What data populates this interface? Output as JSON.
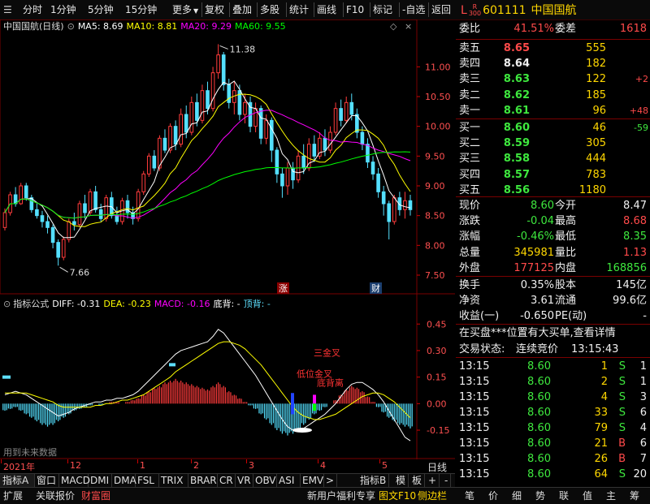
{
  "toolbar": {
    "left_items": [
      "分时",
      "1分钟",
      "5分钟",
      "15分钟",
      "更多"
    ],
    "right_items": [
      "复权",
      "叠加",
      "多股",
      "统计",
      "画线",
      "F10",
      "标记",
      "-自选",
      "返回"
    ]
  },
  "main_chart": {
    "title": "中国国航(日线)",
    "ma5": "MA5: 8.69",
    "ma10": "MA10: 8.81",
    "ma20": "MA20: 9.29",
    "ma60": "MA60: 9.55",
    "high_label": "11.38",
    "low_label": "7.66",
    "rise_mark": "涨",
    "fin_mark": "财"
  },
  "sub_chart": {
    "title": "指标公式",
    "diff": "DIFF: -0.31",
    "dea": "DEA: -0.23",
    "macd": "MACD: -0.16",
    "dibei": "底背: -",
    "dingbei": "顶背: -",
    "ann1": "三金叉",
    "ann2": "低位金叉",
    "ann3": "底背离",
    "future": "用到未来数据"
  },
  "colors": {
    "up": "#ff3b3b",
    "down": "#54e0ff",
    "ma5": "#ffffff",
    "ma10": "#ffff00",
    "ma20": "#ff00ff",
    "ma60": "#00ff00"
  },
  "chart_data": {
    "type": "candlestick",
    "price_axis": [
      "11.00",
      "10.50",
      "10.00",
      "9.50",
      "9.00",
      "8.50",
      "8.00",
      "7.50"
    ],
    "price_range": [
      7.35,
      11.55
    ],
    "macd_axis": [
      "0.45",
      "0.30",
      "0.15",
      "0.00",
      "-0.15"
    ],
    "macd_range": [
      -0.26,
      0.52
    ],
    "time_ticks": [
      "2021年",
      "12",
      "1",
      "2",
      "3",
      "4",
      "5"
    ],
    "candles": [
      [
        8.3,
        8.55,
        8.25,
        8.62
      ],
      [
        8.55,
        8.85,
        8.5,
        8.9
      ],
      [
        8.85,
        8.7,
        8.65,
        8.98
      ],
      [
        8.7,
        9.0,
        8.68,
        9.05
      ],
      [
        9.0,
        8.8,
        8.75,
        9.05
      ],
      [
        8.8,
        8.6,
        8.55,
        8.85
      ],
      [
        8.6,
        8.5,
        8.45,
        8.7
      ],
      [
        8.5,
        8.4,
        8.3,
        8.58
      ],
      [
        8.4,
        8.3,
        8.2,
        8.5
      ],
      [
        8.3,
        8.05,
        7.95,
        8.35
      ],
      [
        8.05,
        7.8,
        7.66,
        8.1
      ],
      [
        7.8,
        8.1,
        7.75,
        8.15
      ],
      [
        8.1,
        8.4,
        8.05,
        8.45
      ],
      [
        8.4,
        8.35,
        8.25,
        8.55
      ],
      [
        8.35,
        8.7,
        8.3,
        8.75
      ],
      [
        8.7,
        8.55,
        8.45,
        8.85
      ],
      [
        8.55,
        8.9,
        8.5,
        8.95
      ],
      [
        8.9,
        8.6,
        8.55,
        9.0
      ],
      [
        8.6,
        8.45,
        8.4,
        8.7
      ],
      [
        8.45,
        8.8,
        8.4,
        8.85
      ],
      [
        8.8,
        8.5,
        8.45,
        8.9
      ],
      [
        8.5,
        8.4,
        8.35,
        8.65
      ],
      [
        8.4,
        8.75,
        8.35,
        8.8
      ],
      [
        8.75,
        8.55,
        8.45,
        8.85
      ],
      [
        8.55,
        8.45,
        8.35,
        8.65
      ],
      [
        8.45,
        8.9,
        8.4,
        8.95
      ],
      [
        8.9,
        9.2,
        8.85,
        9.25
      ],
      [
        9.2,
        9.5,
        9.15,
        9.55
      ],
      [
        9.5,
        9.3,
        9.25,
        9.6
      ],
      [
        9.3,
        9.8,
        9.25,
        9.85
      ],
      [
        9.8,
        9.6,
        9.55,
        9.95
      ],
      [
        9.6,
        10.0,
        9.55,
        10.05
      ],
      [
        10.0,
        9.7,
        9.6,
        10.1
      ],
      [
        9.7,
        10.2,
        9.65,
        10.3
      ],
      [
        10.2,
        9.9,
        9.8,
        10.35
      ],
      [
        9.9,
        10.4,
        9.85,
        10.5
      ],
      [
        10.4,
        10.1,
        10.0,
        10.55
      ],
      [
        10.1,
        10.6,
        10.05,
        10.7
      ],
      [
        10.6,
        10.3,
        10.2,
        10.75
      ],
      [
        10.3,
        10.9,
        10.25,
        11.0
      ],
      [
        10.9,
        11.2,
        10.8,
        11.38
      ],
      [
        11.2,
        10.7,
        10.6,
        11.25
      ],
      [
        10.7,
        10.4,
        10.3,
        10.8
      ],
      [
        10.4,
        10.6,
        10.2,
        10.75
      ],
      [
        10.6,
        10.2,
        10.1,
        10.7
      ],
      [
        10.2,
        10.4,
        10.05,
        10.55
      ],
      [
        10.4,
        10.0,
        9.9,
        10.5
      ],
      [
        10.0,
        10.3,
        9.9,
        10.4
      ],
      [
        10.3,
        9.8,
        9.7,
        10.35
      ],
      [
        9.8,
        10.1,
        9.7,
        10.2
      ],
      [
        10.1,
        9.6,
        9.4,
        10.15
      ],
      [
        9.6,
        9.2,
        9.05,
        9.65
      ],
      [
        9.2,
        9.0,
        8.8,
        9.3
      ],
      [
        9.0,
        9.3,
        8.85,
        9.4
      ],
      [
        9.3,
        9.1,
        8.95,
        9.4
      ],
      [
        9.1,
        9.5,
        9.05,
        9.6
      ],
      [
        9.5,
        9.3,
        9.2,
        9.7
      ],
      [
        9.3,
        9.7,
        9.25,
        9.8
      ],
      [
        9.7,
        9.5,
        9.4,
        9.85
      ],
      [
        9.5,
        9.8,
        9.45,
        9.9
      ],
      [
        9.8,
        9.6,
        9.5,
        9.95
      ],
      [
        9.6,
        9.9,
        9.55,
        10.0
      ],
      [
        9.9,
        10.3,
        9.85,
        10.4
      ],
      [
        10.3,
        10.1,
        10.0,
        10.45
      ],
      [
        10.1,
        10.4,
        10.05,
        10.5
      ],
      [
        10.4,
        10.2,
        10.1,
        10.55
      ],
      [
        10.2,
        9.9,
        9.8,
        10.3
      ],
      [
        9.9,
        9.7,
        9.6,
        10.0
      ],
      [
        9.7,
        9.4,
        9.3,
        9.8
      ],
      [
        9.4,
        9.2,
        9.1,
        9.5
      ],
      [
        9.2,
        8.9,
        8.8,
        9.3
      ],
      [
        8.9,
        8.7,
        8.5,
        9.0
      ],
      [
        8.7,
        8.4,
        8.1,
        8.75
      ],
      [
        8.4,
        8.8,
        8.35,
        8.85
      ],
      [
        8.8,
        8.6,
        8.5,
        8.9
      ],
      [
        8.6,
        8.75,
        8.45,
        8.9
      ],
      [
        8.75,
        8.6,
        8.5,
        8.85
      ]
    ],
    "macd_hist": [
      -0.04,
      -0.03,
      -0.02,
      -0.04,
      -0.06,
      -0.08,
      -0.1,
      -0.12,
      -0.13,
      -0.12,
      -0.1,
      -0.08,
      -0.06,
      -0.04,
      -0.03,
      -0.02,
      -0.01,
      0.0,
      -0.01,
      0.0,
      0.01,
      0.01,
      0.0,
      0.01,
      0.02,
      0.03,
      0.05,
      0.07,
      0.09,
      0.1,
      0.12,
      0.13,
      0.14,
      0.13,
      0.12,
      0.11,
      0.1,
      0.09,
      0.08,
      0.1,
      0.12,
      0.1,
      0.07,
      0.05,
      0.03,
      0.01,
      -0.01,
      -0.03,
      -0.06,
      -0.09,
      -0.12,
      -0.15,
      -0.17,
      -0.18,
      -0.17,
      -0.15,
      -0.12,
      -0.09,
      -0.06,
      -0.04,
      -0.02,
      0.0,
      0.02,
      0.05,
      0.08,
      0.1,
      0.09,
      0.07,
      0.04,
      0.01,
      -0.02,
      -0.05,
      -0.08,
      -0.1,
      -0.12,
      -0.13,
      -0.14
    ],
    "diff": [
      0.05,
      0.06,
      0.07,
      0.06,
      0.05,
      0.03,
      0.01,
      -0.01,
      -0.03,
      -0.05,
      -0.07,
      -0.06,
      -0.05,
      -0.03,
      -0.02,
      -0.01,
      0.0,
      0.01,
      0.01,
      0.02,
      0.02,
      0.03,
      0.03,
      0.04,
      0.05,
      0.07,
      0.1,
      0.13,
      0.16,
      0.19,
      0.22,
      0.25,
      0.28,
      0.3,
      0.31,
      0.32,
      0.33,
      0.34,
      0.35,
      0.38,
      0.42,
      0.4,
      0.36,
      0.32,
      0.28,
      0.24,
      0.2,
      0.16,
      0.11,
      0.06,
      0.01,
      -0.04,
      -0.09,
      -0.13,
      -0.15,
      -0.15,
      -0.14,
      -0.12,
      -0.1,
      -0.08,
      -0.06,
      -0.03,
      0.0,
      0.04,
      0.08,
      0.11,
      0.12,
      0.12,
      0.1,
      0.08,
      0.05,
      0.01,
      -0.04,
      -0.09,
      -0.14,
      -0.19,
      -0.21
    ],
    "dea": [
      0.06,
      0.06,
      0.06,
      0.06,
      0.06,
      0.05,
      0.04,
      0.03,
      0.02,
      0.01,
      -0.01,
      -0.02,
      -0.02,
      -0.02,
      -0.02,
      -0.02,
      -0.02,
      -0.01,
      -0.01,
      0.0,
      0.0,
      0.01,
      0.02,
      0.02,
      0.03,
      0.04,
      0.05,
      0.07,
      0.09,
      0.11,
      0.13,
      0.15,
      0.18,
      0.2,
      0.22,
      0.24,
      0.26,
      0.28,
      0.3,
      0.32,
      0.34,
      0.35,
      0.35,
      0.34,
      0.33,
      0.31,
      0.28,
      0.25,
      0.22,
      0.18,
      0.14,
      0.1,
      0.06,
      0.02,
      -0.02,
      -0.05,
      -0.07,
      -0.08,
      -0.09,
      -0.09,
      -0.08,
      -0.07,
      -0.06,
      -0.04,
      -0.02,
      0.0,
      0.02,
      0.04,
      0.05,
      0.06,
      0.06,
      0.05,
      0.03,
      0.01,
      -0.02,
      -0.05,
      -0.08
    ]
  },
  "tabs": [
    "指标A",
    "窗口",
    "MACD",
    "DMI",
    "DMA",
    "FSL",
    "TRIX",
    "BRAR",
    "CR",
    "VR",
    "OBV",
    "ASI",
    "EMV"
  ],
  "tabs_right": [
    "指标B",
    "模",
    "板",
    "+",
    "-"
  ],
  "day_label": "日线",
  "bottom_left": [
    "扩展",
    "关联报价",
    "财富圈"
  ],
  "bottom_promo": "新用户福利专享",
  "bottom_f10": "图文F10",
  "bottom_side": "侧边栏",
  "bottom_right": [
    "笔",
    "价",
    "细",
    "势",
    "联",
    "值",
    "主",
    "筹"
  ],
  "stock": {
    "code_prefix": "L",
    "code_sub_r": "R",
    "code_sub_num": "300",
    "code": "601111",
    "name": "中国国航",
    "weibi_label": "委比",
    "weibi": "41.51%",
    "weicha_label": "委差",
    "weicha": "1618",
    "asks": [
      {
        "label": "卖五",
        "price": "8.65",
        "vol": "555",
        "chg": ""
      },
      {
        "label": "卖四",
        "price": "8.64",
        "vol": "182",
        "chg": ""
      },
      {
        "label": "卖三",
        "price": "8.63",
        "vol": "122",
        "chg": "+2"
      },
      {
        "label": "卖二",
        "price": "8.62",
        "vol": "185",
        "chg": ""
      },
      {
        "label": "卖一",
        "price": "8.61",
        "vol": "96",
        "chg": "+48"
      }
    ],
    "bids": [
      {
        "label": "买一",
        "price": "8.60",
        "vol": "46",
        "chg": "-59"
      },
      {
        "label": "买二",
        "price": "8.59",
        "vol": "305",
        "chg": ""
      },
      {
        "label": "买三",
        "price": "8.58",
        "vol": "444",
        "chg": ""
      },
      {
        "label": "买四",
        "price": "8.57",
        "vol": "783",
        "chg": ""
      },
      {
        "label": "买五",
        "price": "8.56",
        "vol": "1180",
        "chg": ""
      }
    ],
    "quote": [
      {
        "l": "现价",
        "v": "8.60",
        "l2": "今开",
        "v2": "8.47"
      },
      {
        "l": "涨跌",
        "v": "-0.04",
        "l2": "最高",
        "v2": "8.68"
      },
      {
        "l": "涨幅",
        "v": "-0.46%",
        "l2": "最低",
        "v2": "8.35"
      },
      {
        "l": "总量",
        "v": "345981",
        "l2": "量比",
        "v2": "1.13"
      },
      {
        "l": "外盘",
        "v": "177125",
        "l2": "内盘",
        "v2": "168856"
      }
    ],
    "fund": [
      {
        "l": "换手",
        "v": "0.35%",
        "l2": "股本",
        "v2": "145亿"
      },
      {
        "l": "净资",
        "v": "3.61",
        "l2": "流通",
        "v2": "99.6亿"
      },
      {
        "l": "收益(一)",
        "v": "-0.650",
        "l2": "PE(动)",
        "v2": "-"
      }
    ],
    "notice": "在买盘***位置有大买单,查看详情",
    "status_label": "交易状态:",
    "status": "连续竞价",
    "status_time": "13:15:43",
    "ticks": [
      {
        "t": "13:15",
        "p": "8.60",
        "v": "1",
        "d": "S",
        "n": "1"
      },
      {
        "t": "13:15",
        "p": "8.60",
        "v": "2",
        "d": "S",
        "n": "1"
      },
      {
        "t": "13:15",
        "p": "8.60",
        "v": "4",
        "d": "S",
        "n": "3"
      },
      {
        "t": "13:15",
        "p": "8.60",
        "v": "33",
        "d": "S",
        "n": "6"
      },
      {
        "t": "13:15",
        "p": "8.60",
        "v": "79",
        "d": "S",
        "n": "4"
      },
      {
        "t": "13:15",
        "p": "8.60",
        "v": "21",
        "d": "B",
        "n": "6"
      },
      {
        "t": "13:15",
        "p": "8.60",
        "v": "26",
        "d": "B",
        "n": "7"
      },
      {
        "t": "13:15",
        "p": "8.60",
        "v": "64",
        "d": "S",
        "n": "20"
      }
    ]
  }
}
